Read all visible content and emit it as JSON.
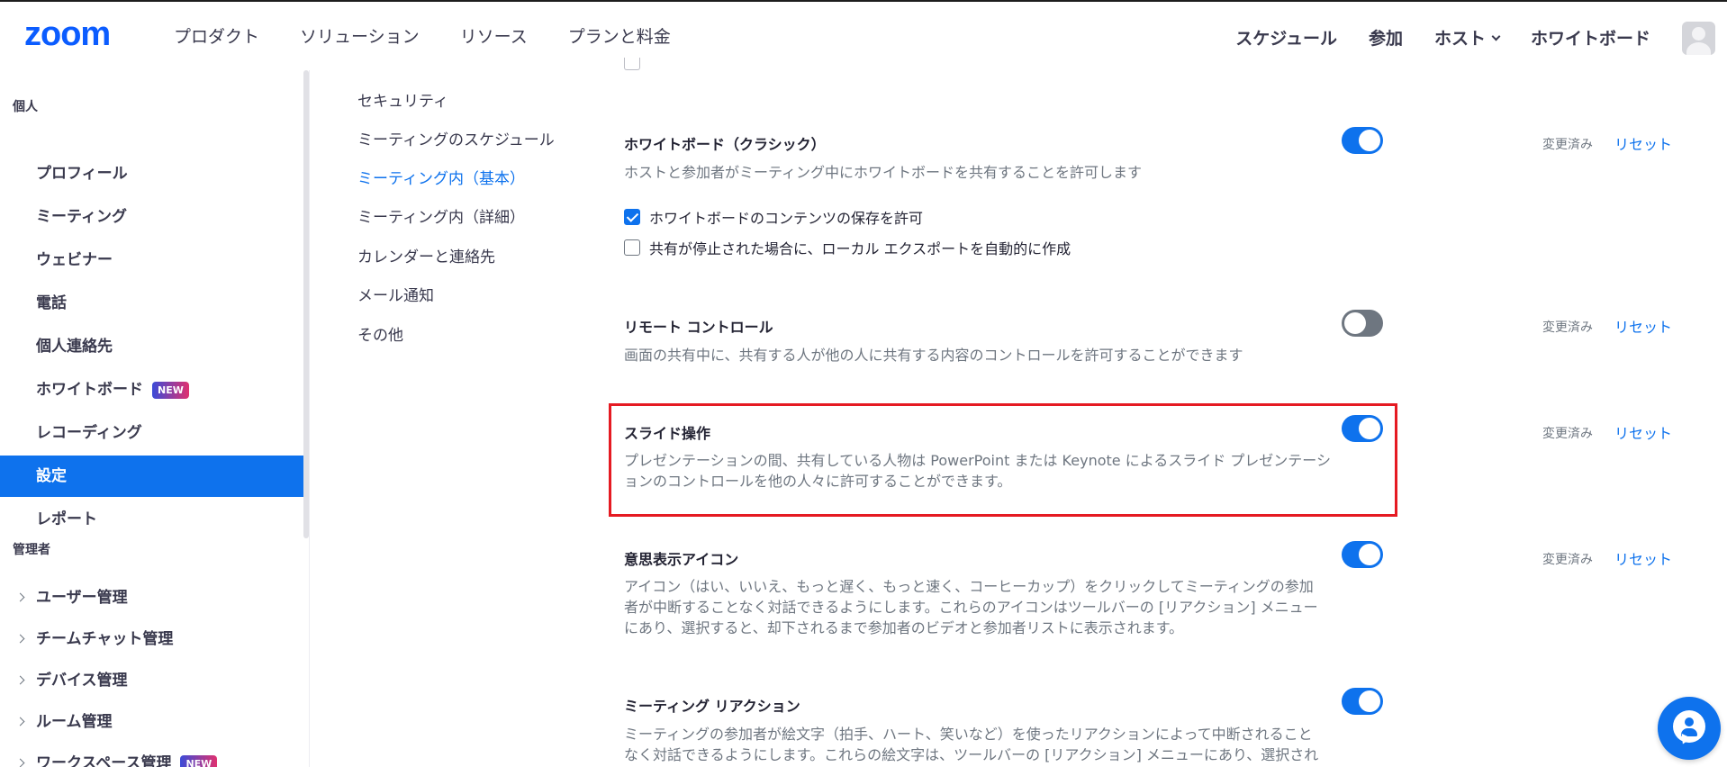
{
  "header": {
    "logo": "zoom",
    "nav_left": [
      "プロダクト",
      "ソリューション",
      "リソース",
      "プランと料金"
    ],
    "schedule": "スケジュール",
    "join": "参加",
    "host": "ホスト",
    "whiteboard": "ホワイトボード"
  },
  "sidebar": {
    "personal_heading": "個人",
    "items": [
      "プロフィール",
      "ミーティング",
      "ウェビナー",
      "電話",
      "個人連絡先",
      "ホワイトボード",
      "レコーディング",
      "設定",
      "レポート"
    ],
    "new_badge": "NEW",
    "active_item": "設定",
    "admin_heading": "管理者",
    "admin_items": [
      "ユーザー管理",
      "チームチャット管理",
      "デバイス管理",
      "ルーム管理",
      "ワークスペース管理"
    ]
  },
  "subnav": {
    "items": [
      "セキュリティ",
      "ミーティングのスケジュール",
      "ミーティング内（基本）",
      "ミーティング内（詳細）",
      "カレンダーと連絡先",
      "メール通知",
      "その他"
    ],
    "active": "ミーティング内（基本）"
  },
  "settings": {
    "changed_label": "変更済み",
    "reset_label": "リセット",
    "whiteboard": {
      "title": "ホワイトボード（クラシック）",
      "desc": "ホストと参加者がミーティング中にホワイトボードを共有することを許可します",
      "enabled": true,
      "options": [
        {
          "label": "ホワイトボードのコンテンツの保存を許可",
          "checked": true
        },
        {
          "label": "共有が停止された場合に、ローカル エクスポートを自動的に作成",
          "checked": false
        }
      ]
    },
    "remote_control": {
      "title": "リモート コントロール",
      "desc": "画面の共有中に、共有する人が他の人に共有する内容のコントロールを許可することができます",
      "enabled": false
    },
    "slide_control": {
      "title": "スライド操作",
      "desc": "プレゼンテーションの間、共有している人物は PowerPoint または Keynote によるスライド プレゼンテーションのコントロールを他の人々に許可することができます。",
      "enabled": true
    },
    "nonverbal": {
      "title": "意思表示アイコン",
      "desc": "アイコン（はい、いいえ、もっと遅く、もっと速く、コーヒーカップ）をクリックしてミーティングの参加者が中断することなく対話できるようにします。これらのアイコンはツールバーの [リアクション] メニューにあり、選択すると、却下されるまで参加者のビデオと参加者リストに表示されます。",
      "enabled": true
    },
    "reactions": {
      "title": "ミーティング リアクション",
      "desc": "ミーティングの参加者が絵文字（拍手、ハート、笑いなど）を使ったリアクションによって中断されることなく対話できるようにします。これらの絵文字は、ツールバーの [リアクション] メニューにあり、選択され",
      "enabled": true
    }
  },
  "colors": {
    "brand": "#0b5cff",
    "accent": "#0e72ed",
    "highlight_border": "#e51a22"
  }
}
